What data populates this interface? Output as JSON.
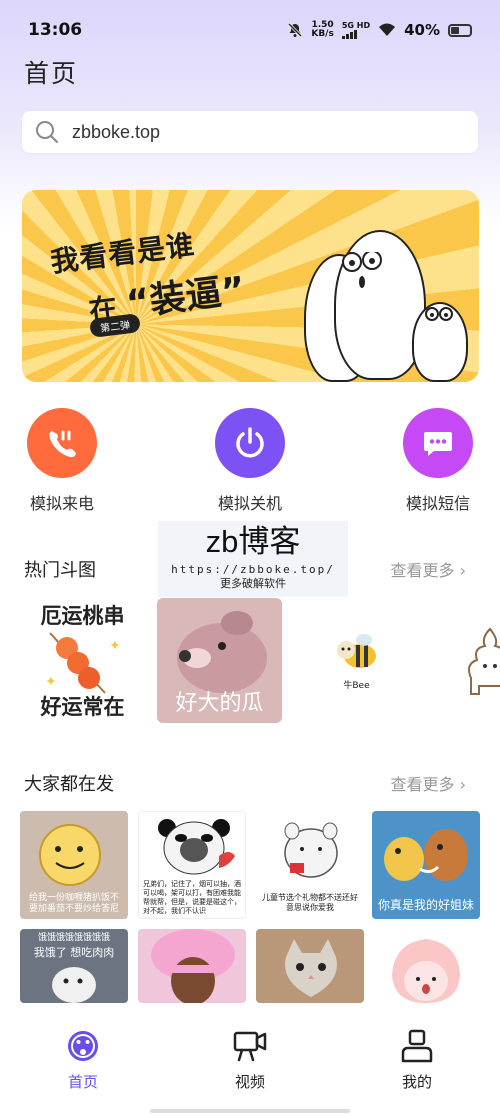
{
  "status_bar": {
    "time": "13:06",
    "net_speed_value": "1.50",
    "net_speed_unit": "KB/s",
    "signal_label": "5G HD",
    "battery": "40%",
    "battery_level": 0.4
  },
  "header": {
    "title": "首页"
  },
  "search": {
    "value": "zbboke.top"
  },
  "banner": {
    "line1": "我看看是谁",
    "line2_prefix": "在",
    "line2_main": "“装逼”",
    "badge": "第二弹"
  },
  "quick_actions": [
    {
      "label": "模拟来电",
      "color": "#ff6b3d",
      "icon": "phone-icon"
    },
    {
      "label": "模拟关机",
      "color": "#7d52f4",
      "icon": "power-icon"
    },
    {
      "label": "模拟短信",
      "color": "#c549f4",
      "icon": "message-icon"
    }
  ],
  "watermark": {
    "title": "zb博客",
    "url": "https://zbboke.top/",
    "subtitle": "更多破解软件"
  },
  "hot_section": {
    "title": "热门斗图",
    "more": "查看更多 ›",
    "items": [
      {
        "text_top": "厄运桃串",
        "text_bottom": "好运常在"
      },
      {
        "text": "好大的瓜"
      },
      {
        "text": "牛Bee"
      },
      {
        "text": ""
      }
    ]
  },
  "popular_section": {
    "title": "大家都在发",
    "more": "查看更多 ›",
    "row1": [
      {
        "caption": "给我一份咖喱猪扒饭不要加番茄不要炒给答尼"
      },
      {
        "caption": "兄弟们，记住了，烟可以抽，酒可以喝，架可以打，有困难我能帮就帮，但是，说要是碰这个，对不起，我们不认识"
      },
      {
        "caption": "儿童节选个礼物都不送还好意思说你爱我"
      },
      {
        "caption": "你真是我的好姐妹"
      }
    ],
    "row2": [
      {
        "caption_top": "饿饿饿饿饿饿饿饿",
        "caption_mid": "我饿了 想吃肉肉"
      },
      {
        "caption": ""
      },
      {
        "caption": ""
      },
      {
        "caption": ""
      }
    ]
  },
  "tab_bar": [
    {
      "label": "首页",
      "icon": "home-smile-icon",
      "active": true
    },
    {
      "label": "视频",
      "icon": "video-camera-icon",
      "active": false
    },
    {
      "label": "我的",
      "icon": "user-icon",
      "active": false
    }
  ]
}
